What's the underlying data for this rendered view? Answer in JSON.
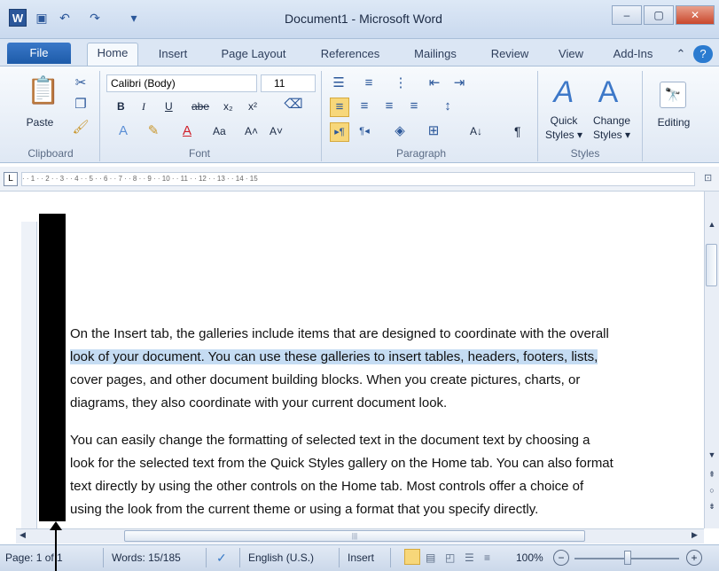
{
  "titlebar": {
    "app_icon": "W",
    "title": "Document1 - Microsoft Word",
    "qat": [
      {
        "icon": "save-icon",
        "glyph": "▣"
      },
      {
        "icon": "undo-icon",
        "glyph": "↶"
      },
      {
        "icon": "redo-icon",
        "glyph": "↷"
      },
      {
        "icon": "customize-qat-icon",
        "glyph": "▾"
      }
    ],
    "min": "–",
    "max": "▢",
    "close": "✕"
  },
  "tabs": {
    "file": "File",
    "items": [
      "Home",
      "Insert",
      "Page Layout",
      "References",
      "Mailings",
      "Review",
      "View",
      "Add-Ins"
    ]
  },
  "ribbon": {
    "clipboard": {
      "paste": "Paste",
      "label": "Clipboard"
    },
    "font": {
      "name": "Calibri (Body)",
      "size": "11",
      "label": "Font",
      "bold": "B",
      "italic": "I",
      "underline": "U",
      "strike": "abe",
      "sub": "x₂",
      "sup": "x²",
      "change_case": "Aa",
      "grow": "A˄",
      "shrink": "A˅"
    },
    "paragraph": {
      "label": "Paragraph",
      "show_marks": "¶",
      "sort": "A↓"
    },
    "styles": {
      "quick": "Quick",
      "quick2": "Styles",
      "change": "Change",
      "change2": "Styles",
      "label": "Styles"
    },
    "editing": {
      "label": "Editing"
    }
  },
  "ruler": {
    "marks": "·  ·  1  ·  ·  2  ·  ·  3  ·  ·  4  ·  ·  5  ·  ·  6  ·  ·  7  ·  ·  8  ·  ·  9  ·  ·  10  ·  ·  11  ·  ·  12  ·  ·  13  ·  ·  14  ·  15"
  },
  "document": {
    "p1_line1": "On the Insert tab, the galleries include items that are designed to coordinate with the overall",
    "p1_line2": "look of your document. You can use these galleries to insert tables, headers, footers, lists,",
    "p1_line3": "cover pages, and other document building blocks. When you create pictures, charts, or",
    "p1_line4": "diagrams, they also coordinate with your current document look.",
    "p2_line1": "You can easily change the formatting of selected text in the document text by choosing a",
    "p2_line2": "look for the selected text from the Quick Styles gallery on the Home tab. You can also format",
    "p2_line3": "text directly by using the other controls on the Home tab. Most controls offer a choice of",
    "p2_line4": "using the look from the current theme or using a format that you specify directly."
  },
  "status": {
    "page": "Page: 1 of 1",
    "words": "Words: 15/185",
    "language": "English (U.S.)",
    "mode": "Insert",
    "zoom": "100%",
    "zoom_minus": "−",
    "zoom_plus": "+"
  }
}
